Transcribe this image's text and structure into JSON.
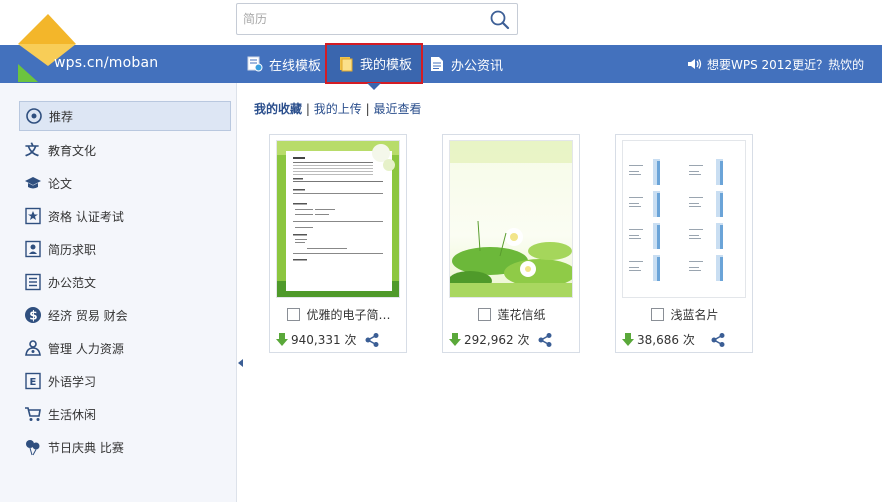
{
  "search": {
    "placeholder": "简历"
  },
  "brand": {
    "text": "wps.cn/moban"
  },
  "nav": [
    {
      "label": "在线模板"
    },
    {
      "label": "我的模板"
    },
    {
      "label": "办公资讯"
    }
  ],
  "notice": {
    "text": "想要WPS 2012更近？热饮的"
  },
  "sidebar": [
    {
      "label": "推荐"
    },
    {
      "label": "教育文化"
    },
    {
      "label": "论文"
    },
    {
      "label": "资格 认证考试"
    },
    {
      "label": "简历求职"
    },
    {
      "label": "办公范文"
    },
    {
      "label": "经济 贸易 财会"
    },
    {
      "label": "管理 人力资源"
    },
    {
      "label": "外语学习"
    },
    {
      "label": "生活休闲"
    },
    {
      "label": "节日庆典 比赛"
    }
  ],
  "tabs": {
    "favorites": "我的收藏",
    "uploads": "我的上传",
    "recent": "最近查看",
    "sep": "|"
  },
  "cards": [
    {
      "title": "优雅的电子简…",
      "downloads": "940,331",
      "unit": "次"
    },
    {
      "title": "莲花信纸",
      "downloads": "292,962",
      "unit": "次"
    },
    {
      "title": "浅蓝名片",
      "downloads": "38,686",
      "unit": "次"
    }
  ],
  "colors": {
    "bar": "#4371bd",
    "active_border": "#d41c24",
    "download": "#5aa83a"
  }
}
